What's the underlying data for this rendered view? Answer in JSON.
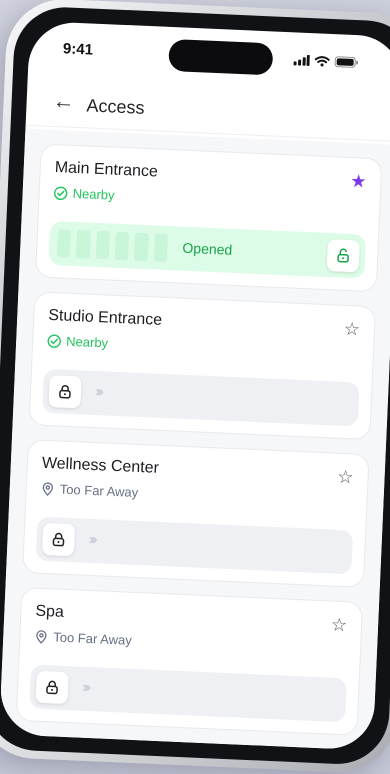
{
  "status_bar": {
    "time": "9:41"
  },
  "header": {
    "title": "Access",
    "back_icon": "arrow-left-icon"
  },
  "colors": {
    "accent": "#7c3aed",
    "nearby": "#22c55e",
    "opened_bg": "#dcfce7",
    "muted": "#667085"
  },
  "doors": [
    {
      "name": "Main Entrance",
      "status": "Nearby",
      "favorite": true,
      "state": "opened",
      "state_label": "Opened"
    },
    {
      "name": "Studio Entrance",
      "status": "Nearby",
      "favorite": false,
      "state": "locked"
    },
    {
      "name": "Wellness Center",
      "status": "Too Far Away",
      "favorite": false,
      "state": "locked"
    },
    {
      "name": "Spa",
      "status": "Too Far Away",
      "favorite": false,
      "state": "locked"
    }
  ]
}
